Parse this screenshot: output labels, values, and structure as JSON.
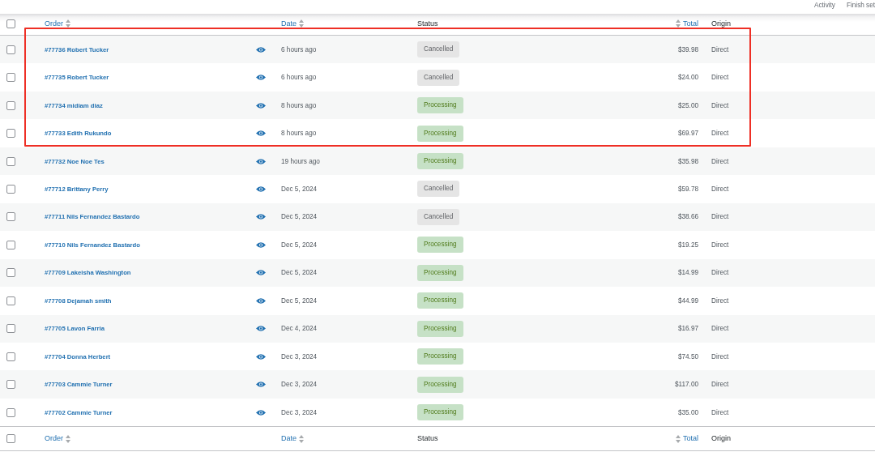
{
  "top_links": [
    {
      "label": "Activity"
    },
    {
      "label": "Finish set"
    }
  ],
  "table": {
    "header": {
      "checked": false,
      "columns": [
        {
          "kind": "order",
          "label": "Order",
          "sortable": true
        },
        {
          "kind": "date",
          "label": "Date",
          "sortable": true
        },
        {
          "kind": "status",
          "label": "Status",
          "sortable": false
        },
        {
          "kind": "total",
          "label": "Total",
          "sortable": true
        },
        {
          "kind": "origin",
          "label": "Origin",
          "sortable": false
        }
      ]
    },
    "rows": [
      {
        "checked": false,
        "highlighted": true,
        "order": "#77736 Robert Tucker",
        "date": "6 hours ago",
        "status": {
          "kind": "cancelled",
          "label": "Cancelled"
        },
        "total": "$39.98",
        "origin": "Direct"
      },
      {
        "checked": false,
        "highlighted": true,
        "order": "#77735 Robert Tucker",
        "date": "6 hours ago",
        "status": {
          "kind": "cancelled",
          "label": "Cancelled"
        },
        "total": "$24.00",
        "origin": "Direct"
      },
      {
        "checked": false,
        "highlighted": true,
        "order": "#77734 midiam diaz",
        "date": "8 hours ago",
        "status": {
          "kind": "processing",
          "label": "Processing"
        },
        "total": "$25.00",
        "origin": "Direct"
      },
      {
        "checked": false,
        "highlighted": true,
        "order": "#77733 Edith Rukundo",
        "date": "8 hours ago",
        "status": {
          "kind": "processing",
          "label": "Processing"
        },
        "total": "$69.97",
        "origin": "Direct"
      },
      {
        "checked": false,
        "highlighted": false,
        "order": "#77732 Noe Noe Tes",
        "date": "19 hours ago",
        "status": {
          "kind": "processing",
          "label": "Processing"
        },
        "total": "$35.98",
        "origin": "Direct"
      },
      {
        "checked": false,
        "highlighted": false,
        "order": "#77712 Brittany Perry",
        "date": "Dec 5, 2024",
        "status": {
          "kind": "cancelled",
          "label": "Cancelled"
        },
        "total": "$59.78",
        "origin": "Direct"
      },
      {
        "checked": false,
        "highlighted": false,
        "order": "#77711 Nils Fernandez Bastardo",
        "date": "Dec 5, 2024",
        "status": {
          "kind": "cancelled",
          "label": "Cancelled"
        },
        "total": "$38.66",
        "origin": "Direct"
      },
      {
        "checked": false,
        "highlighted": false,
        "order": "#77710 Nils Fernandez Bastardo",
        "date": "Dec 5, 2024",
        "status": {
          "kind": "processing",
          "label": "Processing"
        },
        "total": "$19.25",
        "origin": "Direct"
      },
      {
        "checked": false,
        "highlighted": false,
        "order": "#77709 Lakeisha Washington",
        "date": "Dec 5, 2024",
        "status": {
          "kind": "processing",
          "label": "Processing"
        },
        "total": "$14.99",
        "origin": "Direct"
      },
      {
        "checked": false,
        "highlighted": false,
        "order": "#77708 Dejamah smith",
        "date": "Dec 5, 2024",
        "status": {
          "kind": "processing",
          "label": "Processing"
        },
        "total": "$44.99",
        "origin": "Direct"
      },
      {
        "checked": false,
        "highlighted": false,
        "order": "#77705 Lavon Farria",
        "date": "Dec 4, 2024",
        "status": {
          "kind": "processing",
          "label": "Processing"
        },
        "total": "$16.97",
        "origin": "Direct"
      },
      {
        "checked": false,
        "highlighted": false,
        "order": "#77704 Donna Herbert",
        "date": "Dec 3, 2024",
        "status": {
          "kind": "processing",
          "label": "Processing"
        },
        "total": "$74.50",
        "origin": "Direct"
      },
      {
        "checked": false,
        "highlighted": false,
        "order": "#77703 Cammie Turner",
        "date": "Dec 3, 2024",
        "status": {
          "kind": "processing",
          "label": "Processing"
        },
        "total": "$117.00",
        "origin": "Direct"
      },
      {
        "checked": false,
        "highlighted": false,
        "order": "#77702 Cammie Turner",
        "date": "Dec 3, 2024",
        "status": {
          "kind": "processing",
          "label": "Processing"
        },
        "total": "$35.00",
        "origin": "Direct"
      }
    ],
    "footer": {
      "checked": false,
      "columns": [
        {
          "kind": "order",
          "label": "Order",
          "sortable": true
        },
        {
          "kind": "date",
          "label": "Date",
          "sortable": true
        },
        {
          "kind": "status",
          "label": "Status",
          "sortable": false
        },
        {
          "kind": "total",
          "label": "Total",
          "sortable": true
        },
        {
          "kind": "origin",
          "label": "Origin",
          "sortable": false
        }
      ]
    }
  }
}
